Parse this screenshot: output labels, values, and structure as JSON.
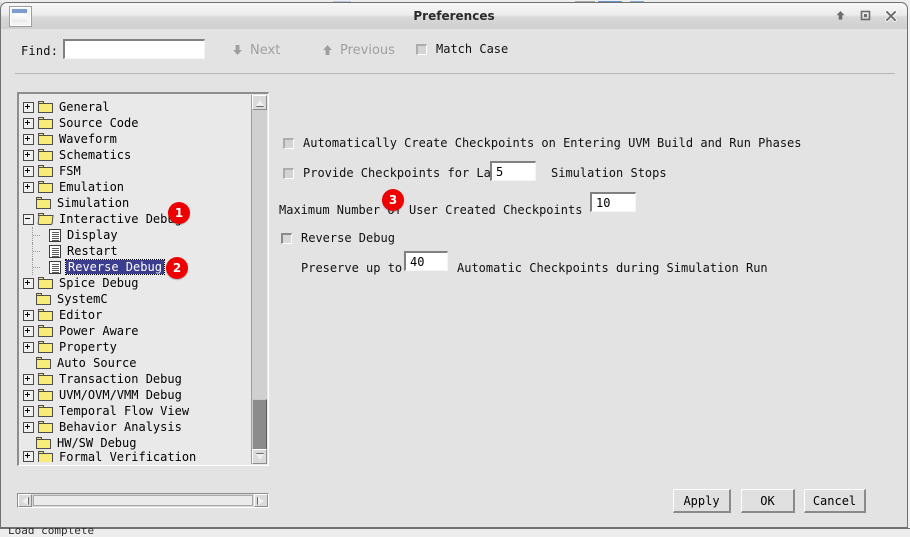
{
  "window": {
    "title": "Preferences",
    "icon": "window-icon",
    "buttons": [
      {
        "name": "shade-button",
        "glyph": "up-arrow"
      },
      {
        "name": "maximize-button",
        "glyph": "square"
      },
      {
        "name": "close-button",
        "glyph": "x"
      }
    ]
  },
  "findbar": {
    "label": "Find:",
    "input_value": "",
    "input_placeholder": "",
    "next_label": "Next",
    "previous_label": "Previous",
    "match_case_label": "Match Case",
    "match_case_checked": false,
    "next_enabled": false,
    "previous_enabled": false
  },
  "tree": {
    "items": [
      {
        "label": "General",
        "type": "folder",
        "expander": "plus",
        "level": 0
      },
      {
        "label": "Source Code",
        "type": "folder",
        "expander": "plus",
        "level": 0
      },
      {
        "label": "Waveform",
        "type": "folder",
        "expander": "plus",
        "level": 0
      },
      {
        "label": "Schematics",
        "type": "folder",
        "expander": "plus",
        "level": 0
      },
      {
        "label": "FSM",
        "type": "folder",
        "expander": "plus",
        "level": 0
      },
      {
        "label": "Emulation",
        "type": "folder",
        "expander": "plus",
        "level": 0
      },
      {
        "label": "Simulation",
        "type": "folder",
        "expander": "none",
        "level": 0
      },
      {
        "label": "Interactive Debug",
        "type": "folder-open",
        "expander": "minus",
        "level": 0
      },
      {
        "label": "Display",
        "type": "doc",
        "expander": "none",
        "level": 1
      },
      {
        "label": "Restart",
        "type": "doc",
        "expander": "none",
        "level": 1
      },
      {
        "label": "Reverse Debug",
        "type": "doc",
        "expander": "none",
        "level": 1,
        "selected": true
      },
      {
        "label": "Spice Debug",
        "type": "folder",
        "expander": "plus",
        "level": 0
      },
      {
        "label": "SystemC",
        "type": "folder",
        "expander": "none",
        "level": 0
      },
      {
        "label": "Editor",
        "type": "folder",
        "expander": "plus",
        "level": 0
      },
      {
        "label": "Power Aware",
        "type": "folder",
        "expander": "plus",
        "level": 0
      },
      {
        "label": "Property",
        "type": "folder",
        "expander": "plus",
        "level": 0
      },
      {
        "label": "Auto Source",
        "type": "folder",
        "expander": "none",
        "level": 0
      },
      {
        "label": "Transaction Debug",
        "type": "folder",
        "expander": "plus",
        "level": 0
      },
      {
        "label": "UVM/OVM/VMM Debug",
        "type": "folder",
        "expander": "plus",
        "level": 0
      },
      {
        "label": "Temporal Flow View",
        "type": "folder",
        "expander": "plus",
        "level": 0
      },
      {
        "label": "Behavior Analysis",
        "type": "folder",
        "expander": "plus",
        "level": 0
      },
      {
        "label": "HW/SW Debug",
        "type": "folder",
        "expander": "none",
        "level": 0
      },
      {
        "label": "Formal Verification",
        "type": "folder",
        "expander": "plus",
        "level": 0,
        "clipped": true
      }
    ]
  },
  "settings": {
    "auto_checkpoints_label": "Automatically Create Checkpoints on Entering UVM Build and Run Phases",
    "auto_checkpoints_checked": false,
    "provide_checkpoints_label": "Provide Checkpoints for Last",
    "provide_checkpoints_value": "5",
    "provide_checkpoints_suffix": "Simulation Stops",
    "provide_checkpoints_checked": false,
    "max_user_checkpoints_label": "Maximum Number of User Created Checkpoints",
    "max_user_checkpoints_value": "10",
    "reverse_debug_label": "Reverse Debug",
    "reverse_debug_checked": false,
    "preserve_label": "Preserve up to",
    "preserve_value": "40",
    "preserve_suffix": "Automatic Checkpoints during Simulation Run"
  },
  "badges": [
    {
      "number": "1",
      "target": "interactive-debug-tree-item"
    },
    {
      "number": "2",
      "target": "reverse-debug-tree-item"
    },
    {
      "number": "3",
      "target": "reverse-debug-checkbox"
    }
  ],
  "footer": {
    "apply_label": "Apply",
    "ok_label": "OK",
    "cancel_label": "Cancel"
  },
  "background": {
    "status_text": "Load complete"
  },
  "colors": {
    "badge": "#ee0000",
    "selection": "#3d3d8f",
    "folder": "#f7ec7a",
    "window_bg": "#e3e3e3"
  }
}
